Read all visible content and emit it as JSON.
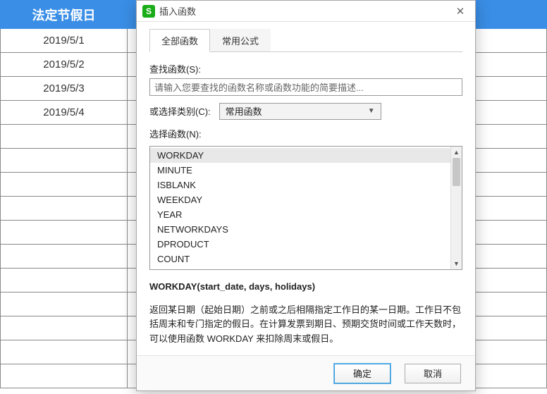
{
  "sheet": {
    "header": "法定节假日",
    "rows": [
      "2019/5/1",
      "2019/5/2",
      "2019/5/3",
      "2019/5/4",
      "",
      "",
      "",
      "",
      "",
      "",
      "",
      "",
      "",
      "",
      ""
    ]
  },
  "dialog": {
    "title": "插入函数",
    "tabs": {
      "all": "全部函数",
      "common": "常用公式"
    },
    "search_label": "查找函数(S):",
    "search_placeholder": "请输入您要查找的函数名称或函数功能的简要描述...",
    "category_label": "或选择类别(C):",
    "category_value": "常用函数",
    "select_label": "选择函数(N):",
    "functions": [
      "WORKDAY",
      "MINUTE",
      "ISBLANK",
      "WEEKDAY",
      "YEAR",
      "NETWORKDAYS",
      "DPRODUCT",
      "COUNT"
    ],
    "signature": "WORKDAY(start_date, days, holidays)",
    "description": "返回某日期（起始日期）之前或之后相隔指定工作日的某一日期。工作日不包括周末和专门指定的假日。在计算发票到期日、预期交货时间或工作天数时，可以使用函数 WORKDAY 来扣除周末或假日。",
    "ok": "确定",
    "cancel": "取消"
  }
}
